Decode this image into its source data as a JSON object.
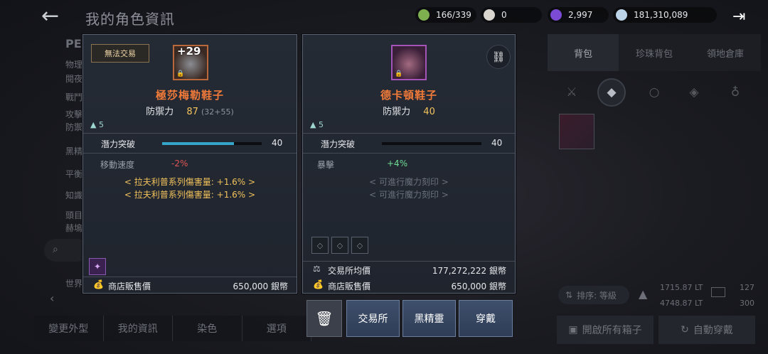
{
  "header": {
    "title": "我的角色資訊",
    "currencies": [
      {
        "icon": "energy-icon",
        "value": "166/339",
        "color": "#7fb04f"
      },
      {
        "icon": "pearl-icon",
        "value": "0",
        "color": "#d9d5cf"
      },
      {
        "icon": "crystal-icon",
        "value": "2,997",
        "color": "#7b4bd6"
      },
      {
        "icon": "silver-icon",
        "value": "181,310,089",
        "color": "#bcd3e8"
      }
    ]
  },
  "background_left": {
    "lines": [
      "PE",
      "物理",
      "閱夜",
      "戰鬥",
      "攻擊",
      "防禦",
      "黑精",
      "平衡",
      "知識",
      "頭目",
      "赫塢",
      "世界"
    ],
    "bottom_tabs": [
      "變更外型",
      "我的資訊",
      "染色",
      "選項"
    ]
  },
  "inventory": {
    "tabs": [
      "背包",
      "珍珠背包",
      "領地倉庫"
    ],
    "sort_label": "排序: 等級",
    "weight_current": "1715.87 LT",
    "weight_max": "4748.87 LT",
    "slots_used": "127",
    "slots_max": "300",
    "open_boxes_label": "開啟所有箱子",
    "auto_equip_label": "自動穿戴"
  },
  "left_item": {
    "badge": "無法交易",
    "enhance": "+29",
    "name": "極莎梅勒鞋子",
    "defense_label": "防禦力",
    "defense_value": "87",
    "defense_detail": "(32+55)",
    "weight_count": "5",
    "potential_label": "潛力突破",
    "potential_value": "40",
    "potential_fill": 0.72,
    "stat_label": "移動速度",
    "stat_value": "-2%",
    "bonuses": [
      "< 拉夫利普系列傷害量: +1.6% >",
      "< 拉夫利普系列傷害量: +1.6% >"
    ],
    "shop_price_label": "商店販售價",
    "shop_price_value": "650,000 銀幣"
  },
  "right_item": {
    "name": "德卡頓鞋子",
    "defense_label": "防禦力",
    "defense_value": "40",
    "weight_count": "5",
    "potential_label": "潛力突破",
    "potential_value": "40",
    "potential_fill": 0,
    "stat_label": "暴擊",
    "stat_value": "+4%",
    "engraves": [
      "< 可進行魔力刻印 >",
      "< 可進行魔力刻印 >"
    ],
    "market_price_label": "交易所均價",
    "market_price_value": "177,272,222 銀幣",
    "shop_price_label": "商店販售價",
    "shop_price_value": "650,000 銀幣"
  },
  "actions": {
    "market": "交易所",
    "black_spirit": "黑精靈",
    "equip": "穿戴"
  }
}
